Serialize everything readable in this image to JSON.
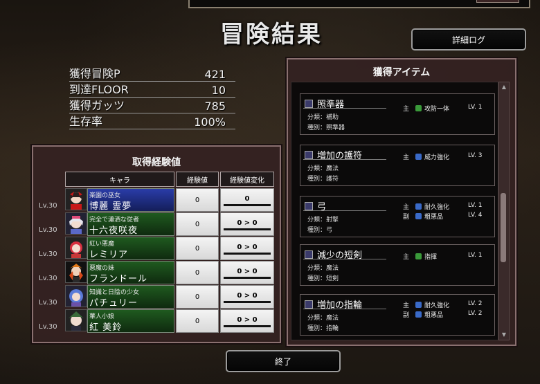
{
  "title": "冒険結果",
  "detail_log_label": "詳細ログ",
  "finish_label": "終了",
  "stats": [
    {
      "label": "獲得冒険P",
      "value": "421"
    },
    {
      "label": "到達FLOOR",
      "value": "10"
    },
    {
      "label": "獲得ガッツ",
      "value": "785"
    },
    {
      "label": "生存率",
      "value": "100%"
    }
  ],
  "exp_panel": {
    "title": "取得経験値",
    "col_chara": "キャラ",
    "col_exp": "経験値",
    "col_change": "経験値変化"
  },
  "characters": [
    {
      "level": "Lv.30",
      "subtitle": "楽園の巫女",
      "name": "博麗 霊夢",
      "exp": "0",
      "change": "0",
      "color": "#1e2e8a"
    },
    {
      "level": "Lv.30",
      "subtitle": "完全で瀟洒な従者",
      "name": "十六夜咲夜",
      "exp": "0",
      "change": "0 > 0",
      "color": "#1f5a1f"
    },
    {
      "level": "Lv.30",
      "subtitle": "紅い悪魔",
      "name": "レミリア",
      "exp": "0",
      "change": "0 > 0",
      "color": "#1f5a1f"
    },
    {
      "level": "Lv.30",
      "subtitle": "悪魔の妹",
      "name": "フランドール",
      "exp": "0",
      "change": "0 > 0",
      "color": "#1f5a1f"
    },
    {
      "level": "Lv.30",
      "subtitle": "知識と日陰の少女",
      "name": "パチュリー",
      "exp": "0",
      "change": "0 > 0",
      "color": "#1f5a1f"
    },
    {
      "level": "Lv.30",
      "subtitle": "華人小娘",
      "name": "紅 美鈴",
      "exp": "0",
      "change": "0 > 0",
      "color": "#1f5a1f"
    }
  ],
  "items_panel": {
    "title": "獲得アイテム",
    "items": [
      {
        "name": "照準器",
        "cat": "分類：補助",
        "kind": "種別：照準器",
        "effects": [
          {
            "slot": "主",
            "badge_color": "#3a9a3a",
            "text": "攻防一体",
            "level": "LV. 1"
          }
        ]
      },
      {
        "name": "増加の護符",
        "cat": "分類：魔法",
        "kind": "種別：護符",
        "effects": [
          {
            "slot": "主",
            "badge_color": "#3a6ac8",
            "text": "威力強化",
            "level": "LV. 3"
          }
        ]
      },
      {
        "name": "弓",
        "cat": "分類：射撃",
        "kind": "種別：弓",
        "effects": [
          {
            "slot": "主",
            "badge_color": "#3a6ac8",
            "text": "耐久強化",
            "level": "LV. 1"
          },
          {
            "slot": "副",
            "badge_color": "#3a6ac8",
            "text": "粗悪品",
            "level": "LV. 4"
          }
        ]
      },
      {
        "name": "減少の短剣",
        "cat": "分類：魔法",
        "kind": "種別：短剣",
        "effects": [
          {
            "slot": "主",
            "badge_color": "#3a9a3a",
            "text": "指揮",
            "level": "LV. 1"
          }
        ]
      },
      {
        "name": "増加の指輪",
        "cat": "分類：魔法",
        "kind": "種別：指輪",
        "effects": [
          {
            "slot": "主",
            "badge_color": "#3a6ac8",
            "text": "耐久強化",
            "level": "LV. 2"
          },
          {
            "slot": "副",
            "badge_color": "#3a6ac8",
            "text": "粗悪品",
            "level": "LV. 2"
          }
        ]
      }
    ]
  }
}
